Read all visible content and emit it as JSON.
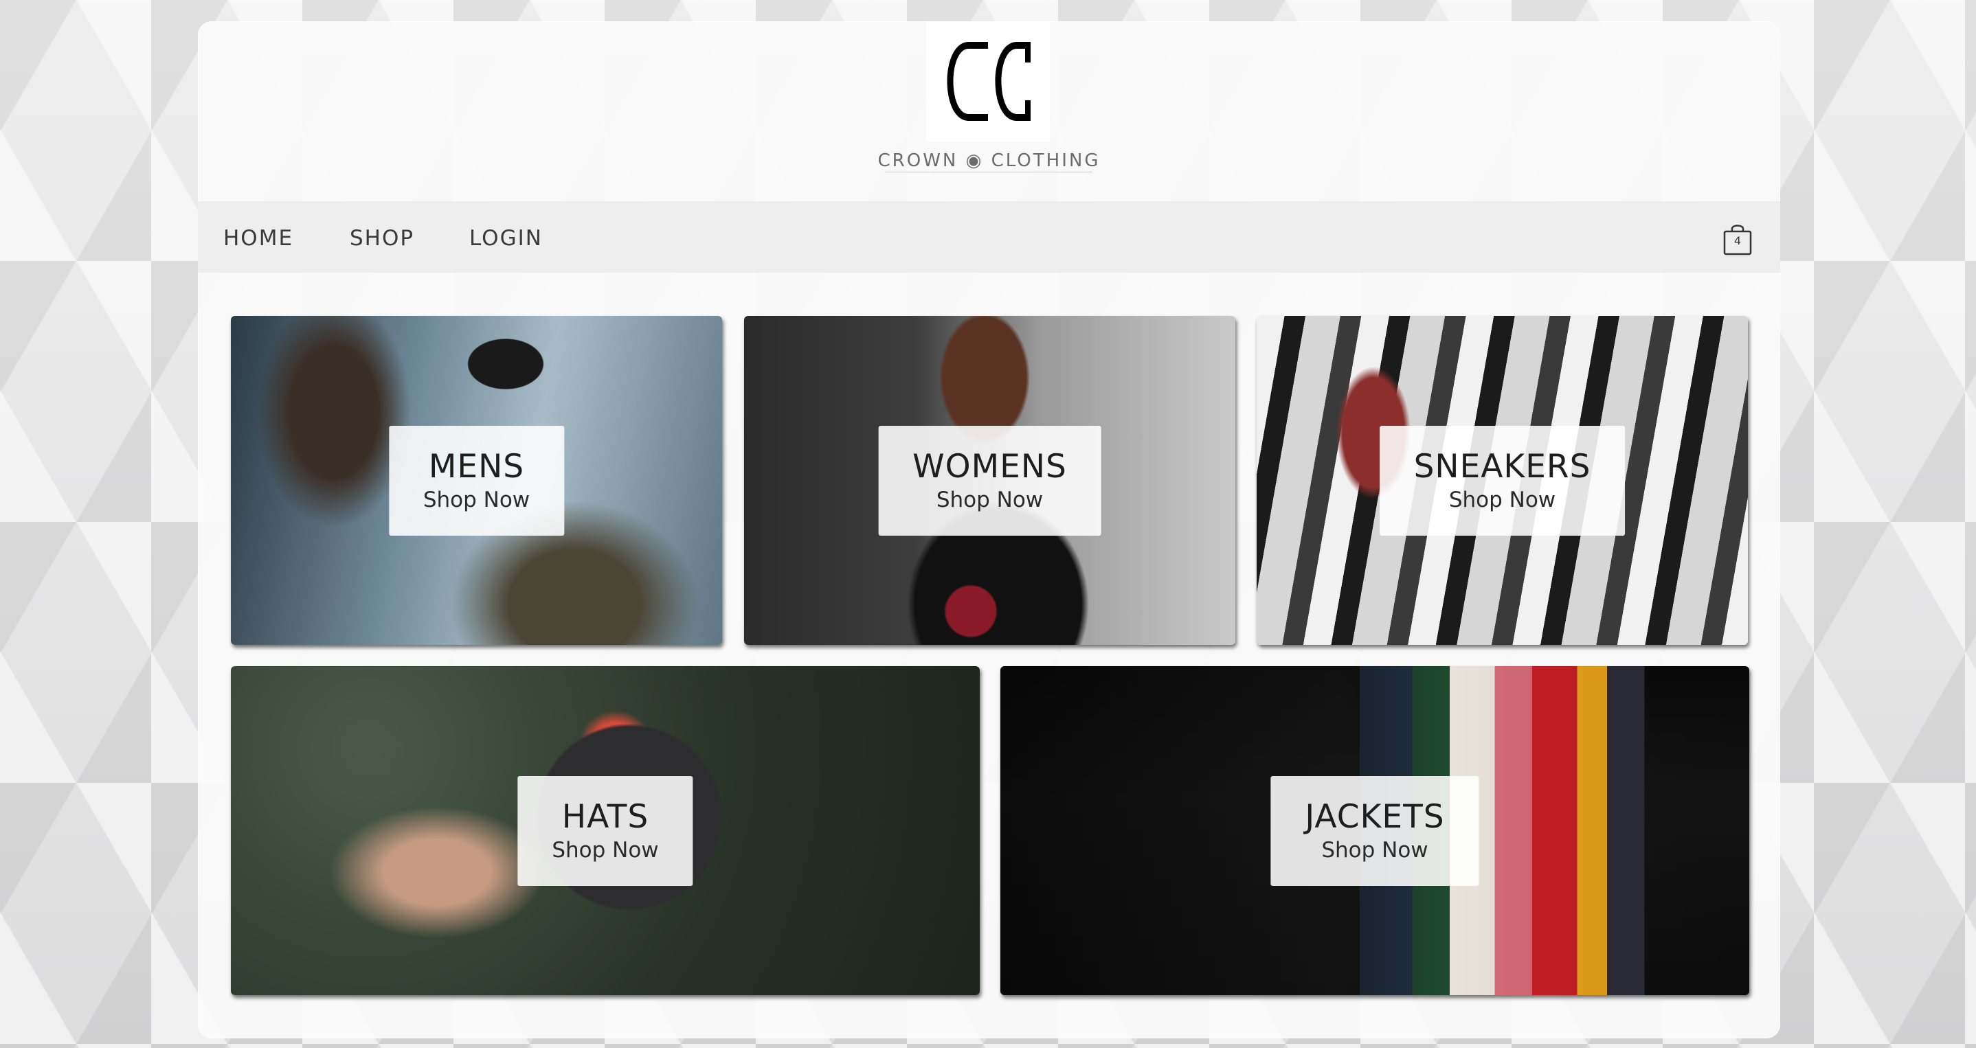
{
  "brand": {
    "name": "CROWN ◉ CLOTHING",
    "logo_icon": "crown-clothing-cc-logo"
  },
  "nav": {
    "home": "HOME",
    "shop": "SHOP",
    "login": "LOGIN",
    "cart_icon": "shopping-bag-icon",
    "cart_count": "4"
  },
  "categories": [
    {
      "title": "MENS",
      "subtitle": "Shop Now"
    },
    {
      "title": "WOMENS",
      "subtitle": "Shop Now"
    },
    {
      "title": "SNEAKERS",
      "subtitle": "Shop Now"
    },
    {
      "title": "HATS",
      "subtitle": "Shop Now"
    },
    {
      "title": "JACKETS",
      "subtitle": "Shop Now"
    }
  ],
  "colors": {
    "text": "#1e1e1e",
    "nav_text": "#3a3a3a",
    "background": "#e9e9ea"
  }
}
